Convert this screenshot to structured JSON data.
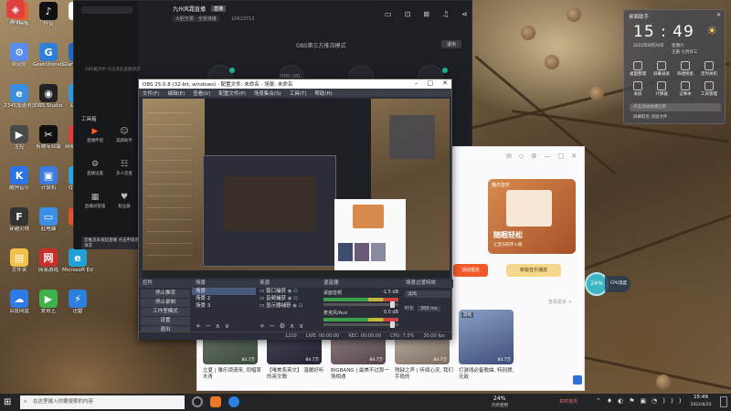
{
  "desktop": {
    "icons": [
      {
        "label": "PPT模板",
        "sub": "",
        "color": "#e8612c",
        "glyph": "P"
      },
      {
        "label": "抖音",
        "sub": "",
        "color": "#111",
        "glyph": "♪"
      },
      {
        "label": "",
        "sub": "",
        "color": "#ffffff",
        "glyph": "✦"
      },
      {
        "label": "自动化",
        "sub": "",
        "color": "#5a8df0",
        "glyph": "⚙"
      },
      {
        "label": "GeekUninstaller",
        "sub": "",
        "color": "#2f7fd8",
        "glyph": "G"
      },
      {
        "label": "Glary Utilities",
        "sub": "",
        "color": "#1d68c4",
        "glyph": "⇌"
      },
      {
        "label": "2345加速浏览器",
        "sub": "",
        "color": "#3b8ee0",
        "glyph": "e"
      },
      {
        "label": "OBS Studio",
        "sub": "",
        "color": "#222",
        "glyph": "◉"
      },
      {
        "label": "回收站",
        "sub": "",
        "color": "#2d9be0",
        "glyph": "▥"
      },
      {
        "label": "主控",
        "sub": "",
        "color": "#4a4a4a",
        "glyph": "▶"
      },
      {
        "label": "剪映专业版",
        "sub": "",
        "color": "#111",
        "glyph": "✂"
      },
      {
        "label": "网易云音乐",
        "sub": "",
        "color": "#e23b3b",
        "glyph": "◎"
      },
      {
        "label": "酷狗音乐",
        "sub": "",
        "color": "#2b74e6",
        "glyph": "K"
      },
      {
        "label": "计算机",
        "sub": "",
        "color": "#3c7be0",
        "glyph": "▣"
      },
      {
        "label": "QQ游戏",
        "sub": "",
        "color": "#2aa6e2",
        "glyph": "Q"
      },
      {
        "label": "穿越火线",
        "sub": "",
        "color": "#333",
        "glyph": "F"
      },
      {
        "label": "此电脑",
        "sub": "",
        "color": "#3a8ee6",
        "glyph": "▭"
      },
      {
        "label": "新闻",
        "sub": "",
        "color": "#e34e2b",
        "glyph": "新"
      },
      {
        "label": "文件夹",
        "sub": "",
        "color": "#f0c14b",
        "glyph": "▤"
      },
      {
        "label": "网易游戏",
        "sub": "",
        "color": "#cc2d2d",
        "glyph": "网"
      },
      {
        "label": "Microsoft Edge",
        "sub": "",
        "color": "#1fa0d8",
        "glyph": "e"
      },
      {
        "label": "百度网盘",
        "sub": "",
        "color": "#2d7be6",
        "glyph": "☁"
      },
      {
        "label": "爱奇艺",
        "sub": "",
        "color": "#3bb34a",
        "glyph": "▶"
      },
      {
        "label": "迅雷",
        "sub": "",
        "color": "#2b80e0",
        "glyph": "⚡"
      },
      {
        "label": "影音",
        "sub": "",
        "color": "#e04040",
        "glyph": "◈"
      }
    ]
  },
  "darkapp": {
    "title": "九州风霜直播",
    "tag": "直播",
    "subtitle": "大胆无畏 · 全景演播",
    "room_id": "10613713",
    "status": "OBS第三方推流模式",
    "status_btn": "退出",
    "left_hint": "OBS推流中 点击发起直播请求",
    "tool_heading": "工具箱",
    "tools": [
      {
        "label": "直播伴侣",
        "icon": "live-icon"
      },
      {
        "label": "美颜助手",
        "icon": "face-icon"
      },
      {
        "label": "直播设置",
        "icon": "setting-icon"
      },
      {
        "label": "多人连麦",
        "icon": "users-icon"
      },
      {
        "label": "直播间管理",
        "icon": "manage-icon"
      },
      {
        "label": "粉丝群",
        "icon": "fans-icon"
      }
    ],
    "rtmp_label": "RMS URL",
    "bottom_notice": "您推流未发起直播 点击申请直播请求"
  },
  "obs": {
    "title": "OBS 25.0.8 (32-bit, windows) - 配置文件: 未命名 - 场景: 未命名",
    "menu": [
      "文件(F)",
      "编辑(E)",
      "查看(V)",
      "配置文件(P)",
      "场景集合(S)",
      "工具(T)",
      "帮助(H)"
    ],
    "panels": {
      "scenes": "场景",
      "sources": "来源",
      "mixer": "混音器",
      "transitions": "场景过渡特效",
      "controls": "控件"
    },
    "scenes": [
      "场景",
      "场景 2",
      "场景 3"
    ],
    "sources": [
      "窗口捕获",
      "音频捕获",
      "显示器捕获"
    ],
    "controls": [
      "停止推流",
      "停止录制",
      "工作室模式",
      "设置",
      "退出"
    ],
    "mixer": [
      {
        "name": "桌面音频",
        "db": "-1.5 dB"
      },
      {
        "name": "麦克风/Aux",
        "db": "0.0 dB"
      }
    ],
    "transition": {
      "name": "淡出",
      "duration_label": "时长",
      "duration": "300 ms"
    },
    "status": {
      "live": "LIVE: 00:00:00",
      "rec": "REC: 00:00:00",
      "cpu": "CPU: 7.5%",
      "fps": "30.00 fps",
      "frames": "1210"
    }
  },
  "music": {
    "banner_tag": "猫爪音乐",
    "banner_title": "随眠轻松",
    "banner_sub": "让音乐陪伴入眠",
    "btn1": "活动报名",
    "btn2": "新版音乐播放",
    "more": "查看更多 >",
    "cards": [
      {
        "tag": "",
        "plays": "84.7万",
        "caption": "立夏 | 雅乐颂请来, 同唱草木青"
      },
      {
        "tag": "",
        "plays": "84.7万",
        "caption": "【唯美系英文】 温暖好听的英文歌"
      },
      {
        "tag": "",
        "plays": "84.7万",
        "caption": "BIGBANG | 最美不过那一场相遇"
      },
      {
        "tag": "轻音乐",
        "plays": "84.7万",
        "caption": "残缺之声 | 听闻心灵, 我们手段的"
      },
      {
        "tag": "游戏",
        "plays": "84.7万",
        "caption": "打游戏必备歌曲, 特别燃, 无敌"
      }
    ]
  },
  "clock": {
    "heading": "桌面助手",
    "time": "15 : 49",
    "date": "2022年8月20日",
    "weekday": "星期六",
    "lunar": "壬寅 七月廿三",
    "weather": "☀",
    "tools": [
      "桌面整理",
      "屏幕录屏",
      "快捷搜索",
      "定时关机",
      "关屏",
      "计算器",
      "记事本",
      "工具管理"
    ],
    "search_placeholder": "点击添加快捷应用",
    "tips": "屏幕取色  添加文件"
  },
  "badge": {
    "value": "24%",
    "label": "CPU温度"
  },
  "taskbar": {
    "search_placeholder": "在这里输入你要搜索的内容",
    "cpu": "24%",
    "cpu_label": "内存使用",
    "notice": "实时资讯",
    "time": "15:49",
    "date": "2022/8/20"
  }
}
